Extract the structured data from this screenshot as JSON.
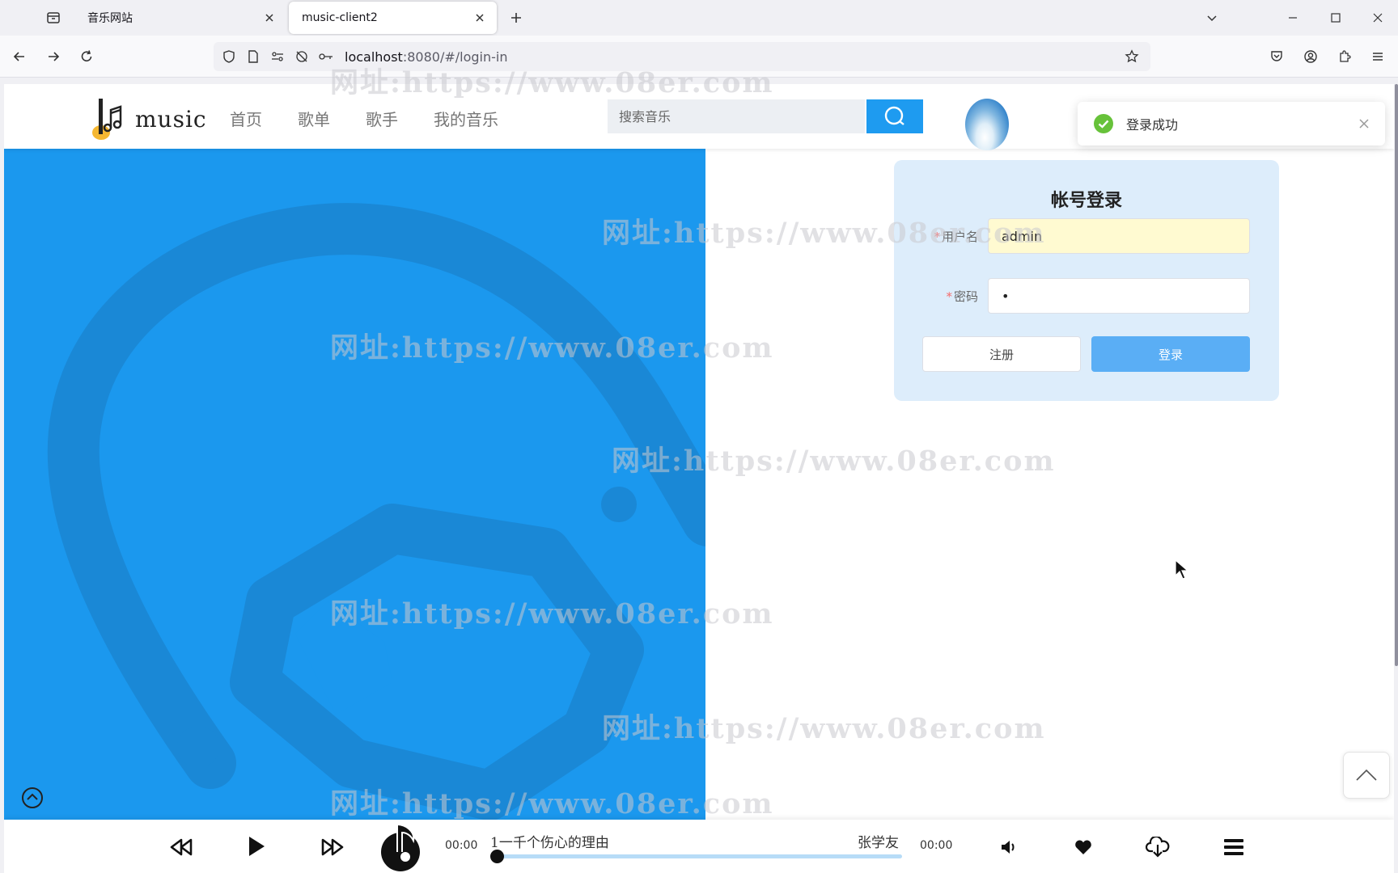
{
  "browser": {
    "tabs": [
      {
        "title": "音乐网站",
        "active": false
      },
      {
        "title": "music-client2",
        "active": true
      }
    ],
    "url_host": "localhost",
    "url_rest": ":8080/#/login-in"
  },
  "site": {
    "logo_text": "music",
    "nav": [
      "首页",
      "歌单",
      "歌手",
      "我的音乐"
    ],
    "search_placeholder": "搜索音乐"
  },
  "toast": {
    "message": "登录成功",
    "status_color": "#67c23a"
  },
  "login": {
    "title": "帐号登录",
    "username_label": "用户名",
    "username_value": "admin",
    "password_label": "密码",
    "password_value": "•",
    "register_label": "注册",
    "login_label": "登录",
    "required_mark": "*"
  },
  "player": {
    "current_time": "00:00",
    "total_time": "00:00",
    "song_title": "1一千个伤心的理由",
    "artist": "张学友",
    "progress": 0
  },
  "watermark": "网址:https://www.08er.com",
  "colors": {
    "accent": "#1e9bf0",
    "panel_blue": "#1b98ee",
    "login_card_bg": "#ddedfb"
  }
}
